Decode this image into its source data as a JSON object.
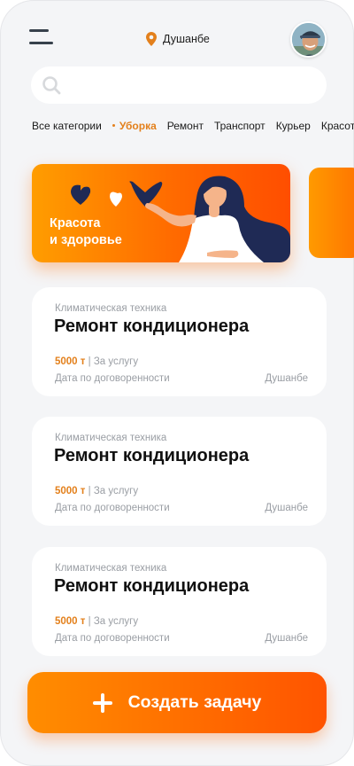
{
  "header": {
    "city": "Душанбе"
  },
  "search": {
    "placeholder": ""
  },
  "categories": [
    "Все категории",
    "Уборка",
    "Ремонт",
    "Транспорт",
    "Курьер",
    "Красота"
  ],
  "active_category": "Уборка",
  "banner": {
    "line1": "Красота",
    "line2": "и здоровье"
  },
  "tasks": [
    {
      "category": "Климатическая техника",
      "title": "Ремонт кондиционера",
      "price": "5000 т",
      "price_note": "За услугу",
      "date": "Дата по договоренности",
      "city": "Душанбе"
    },
    {
      "category": "Климатическая техника",
      "title": "Ремонт кондиционера",
      "price": "5000 т",
      "price_note": "За услугу",
      "date": "Дата по договоренности",
      "city": "Душанбе"
    },
    {
      "category": "Климатическая техника",
      "title": "Ремонт кондиционера",
      "price": "5000 т",
      "price_note": "За услугу",
      "date": "Дата по договоренности",
      "city": "Душанбе"
    }
  ],
  "create_button": {
    "label": "Создать задачу"
  },
  "colors": {
    "accent": "#e3801c",
    "gradient_start": "#ff9d00",
    "gradient_end": "#ff4e00",
    "background": "#f4f5f7"
  },
  "icons": [
    "menu-icon",
    "location-pin-icon",
    "search-icon",
    "plus-icon"
  ]
}
